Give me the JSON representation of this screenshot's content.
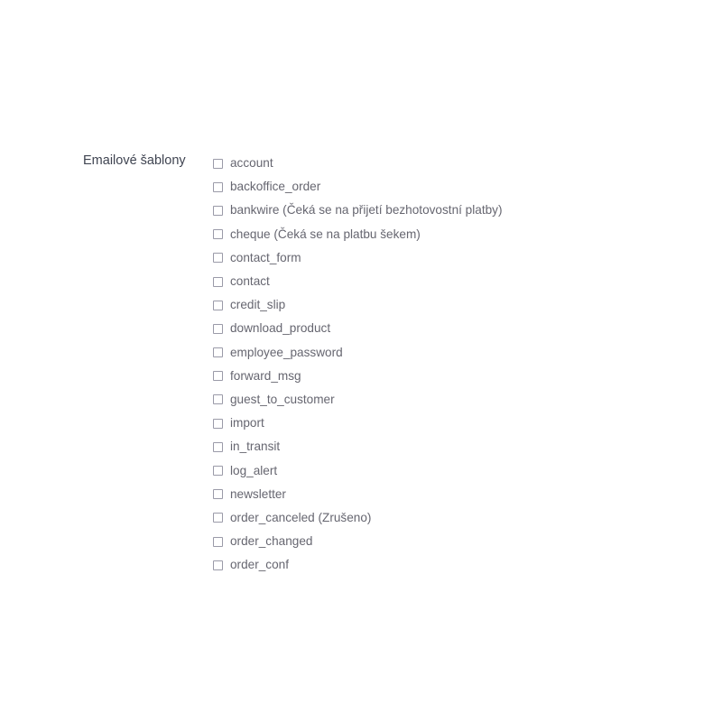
{
  "form": {
    "label": "Emailové šablony",
    "checkbox_border_color": "#9a9aa8",
    "label_color": "#3f4451",
    "item_text_color": "#666670",
    "items": [
      {
        "name": "account",
        "label": "account",
        "checked": false
      },
      {
        "name": "backoffice_order",
        "label": "backoffice_order",
        "checked": false
      },
      {
        "name": "bankwire",
        "label": "bankwire (Čeká se na přijetí bezhotovostní platby)",
        "checked": false
      },
      {
        "name": "cheque",
        "label": "cheque (Čeká se na platbu šekem)",
        "checked": false
      },
      {
        "name": "contact_form",
        "label": "contact_form",
        "checked": false
      },
      {
        "name": "contact",
        "label": "contact",
        "checked": false
      },
      {
        "name": "credit_slip",
        "label": "credit_slip",
        "checked": false
      },
      {
        "name": "download_product",
        "label": "download_product",
        "checked": false
      },
      {
        "name": "employee_password",
        "label": "employee_password",
        "checked": false
      },
      {
        "name": "forward_msg",
        "label": "forward_msg",
        "checked": false
      },
      {
        "name": "guest_to_customer",
        "label": "guest_to_customer",
        "checked": false
      },
      {
        "name": "import",
        "label": "import",
        "checked": false
      },
      {
        "name": "in_transit",
        "label": "in_transit",
        "checked": false
      },
      {
        "name": "log_alert",
        "label": "log_alert",
        "checked": false
      },
      {
        "name": "newsletter",
        "label": "newsletter",
        "checked": false
      },
      {
        "name": "order_canceled",
        "label": "order_canceled (Zrušeno)",
        "checked": false
      },
      {
        "name": "order_changed",
        "label": "order_changed",
        "checked": false
      },
      {
        "name": "order_conf",
        "label": "order_conf",
        "checked": false
      }
    ]
  }
}
